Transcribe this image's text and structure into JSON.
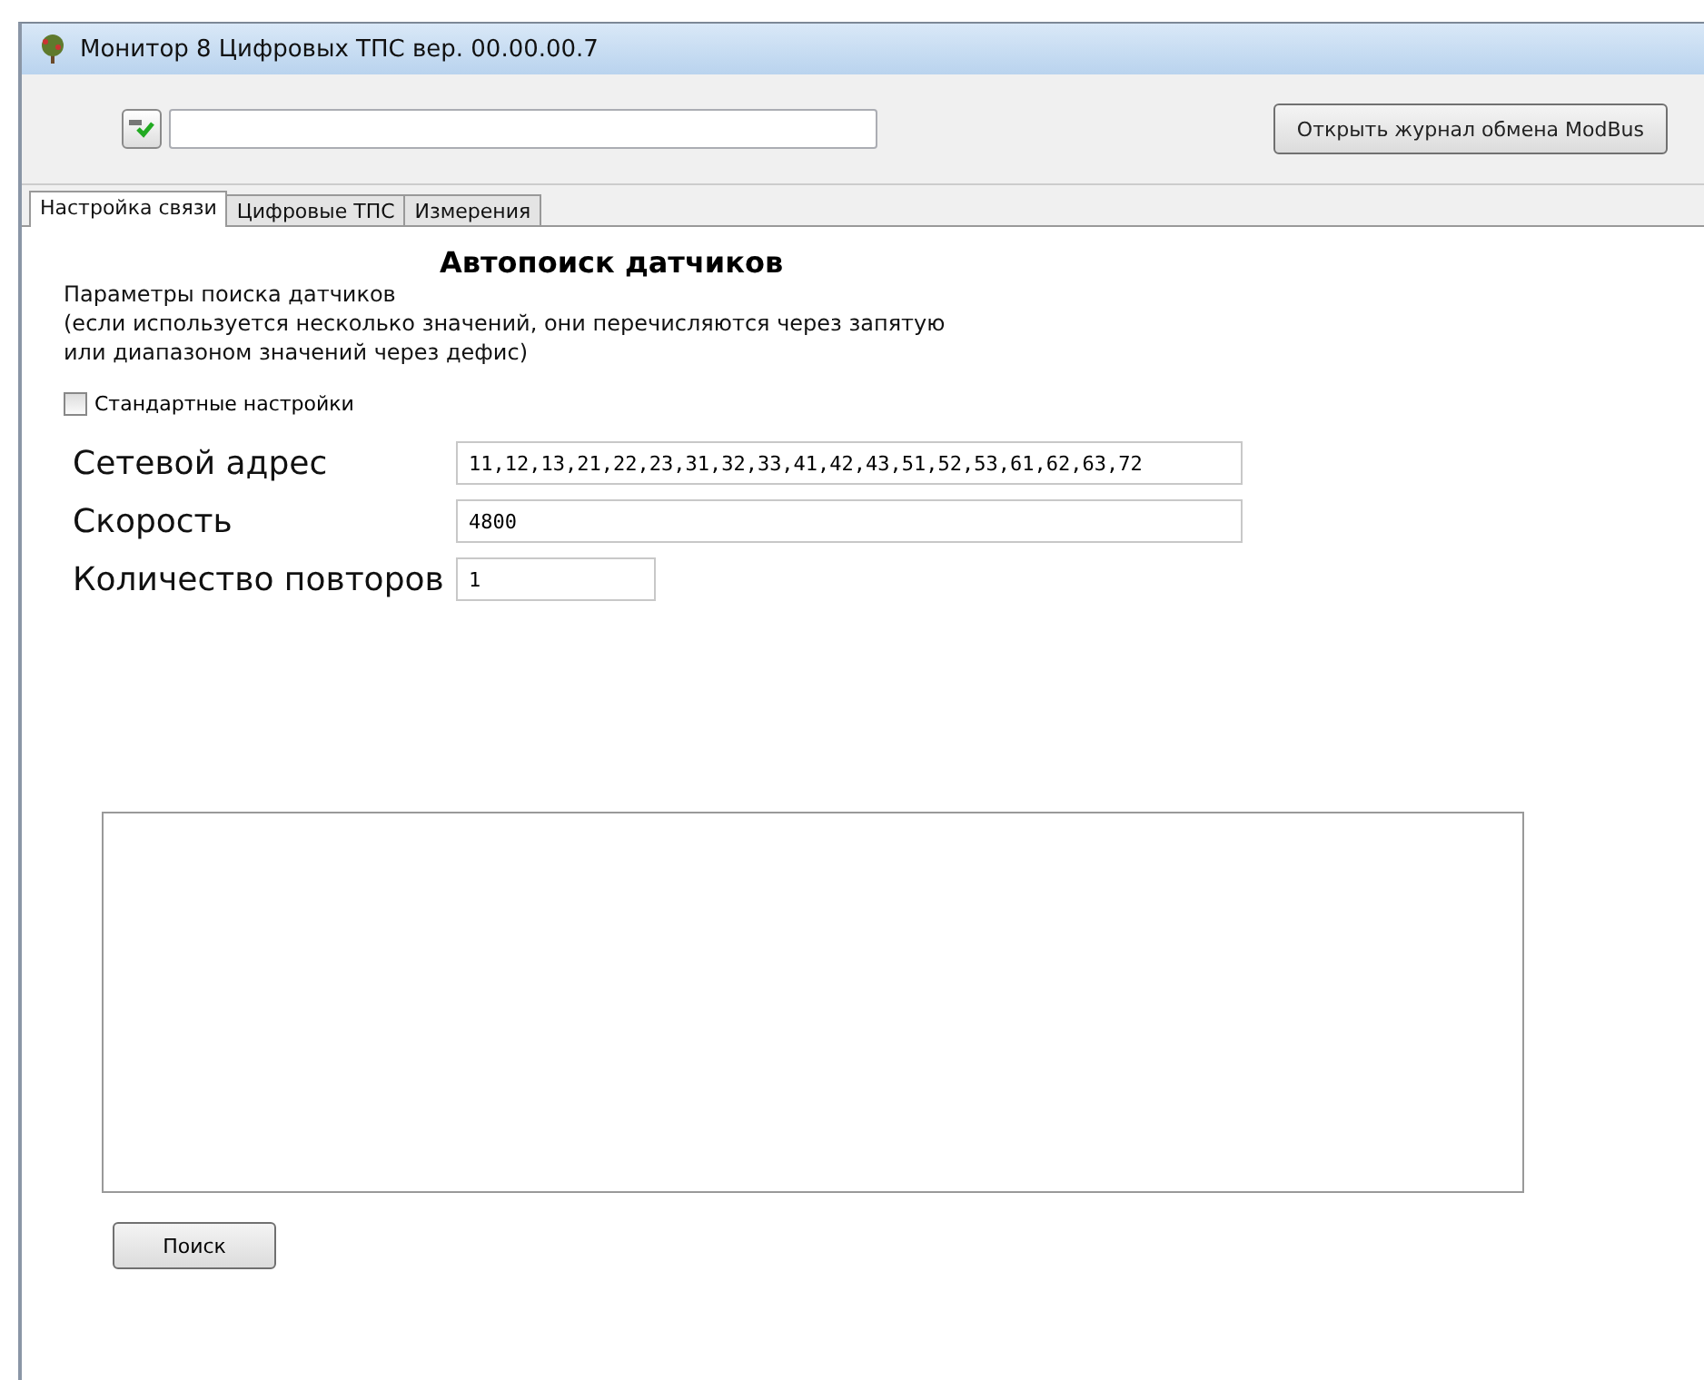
{
  "window": {
    "title": "Монитор 8 Цифровых ТПС вер. 00.00.00.7"
  },
  "toolbar": {
    "log_button": "Открыть журнал обмена ModBus"
  },
  "tabs": [
    {
      "label": "Настройка связи",
      "selected": true
    },
    {
      "label": "Цифровые ТПС",
      "selected": false
    },
    {
      "label": "Измерения",
      "selected": false
    }
  ],
  "autosearch": {
    "heading": "Автопоиск датчиков",
    "description": [
      "Параметры поиска датчиков",
      "(если используется несколько значений,  они перечисляются через запятую",
      "или диапазоном значений через дефис)"
    ],
    "standard_settings": {
      "label": "Стандартные настройки",
      "checked": false
    },
    "fields": [
      {
        "label": "Сетевой адрес",
        "value": "11,12,13,21,22,23,31,32,33,41,42,43,51,52,53,61,62,63,72",
        "kind": "wide"
      },
      {
        "label": "Скорость",
        "value": "4800",
        "kind": "wide"
      },
      {
        "label": "Количество повторов",
        "value": "1",
        "kind": "short"
      }
    ],
    "search_button": "Поиск"
  }
}
